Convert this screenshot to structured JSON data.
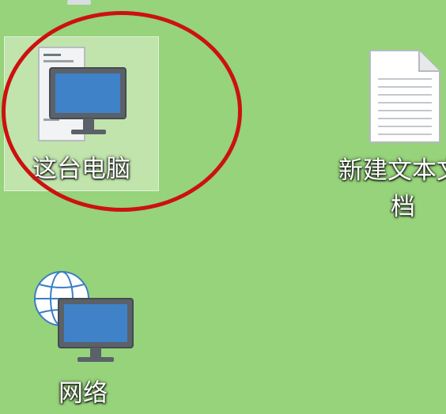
{
  "desktop": {
    "background": "#96d37a",
    "icons": [
      {
        "label": "这台电脑",
        "icon": "this-pc-icon",
        "selected": true
      },
      {
        "label_line1": "新建文本文",
        "label_line2": "档",
        "icon": "text-document-icon",
        "selected": false
      },
      {
        "label": "网络",
        "icon": "network-icon",
        "selected": false
      }
    ],
    "selection_color": "#c8e8b4",
    "annotation_color": "#cc1111"
  }
}
